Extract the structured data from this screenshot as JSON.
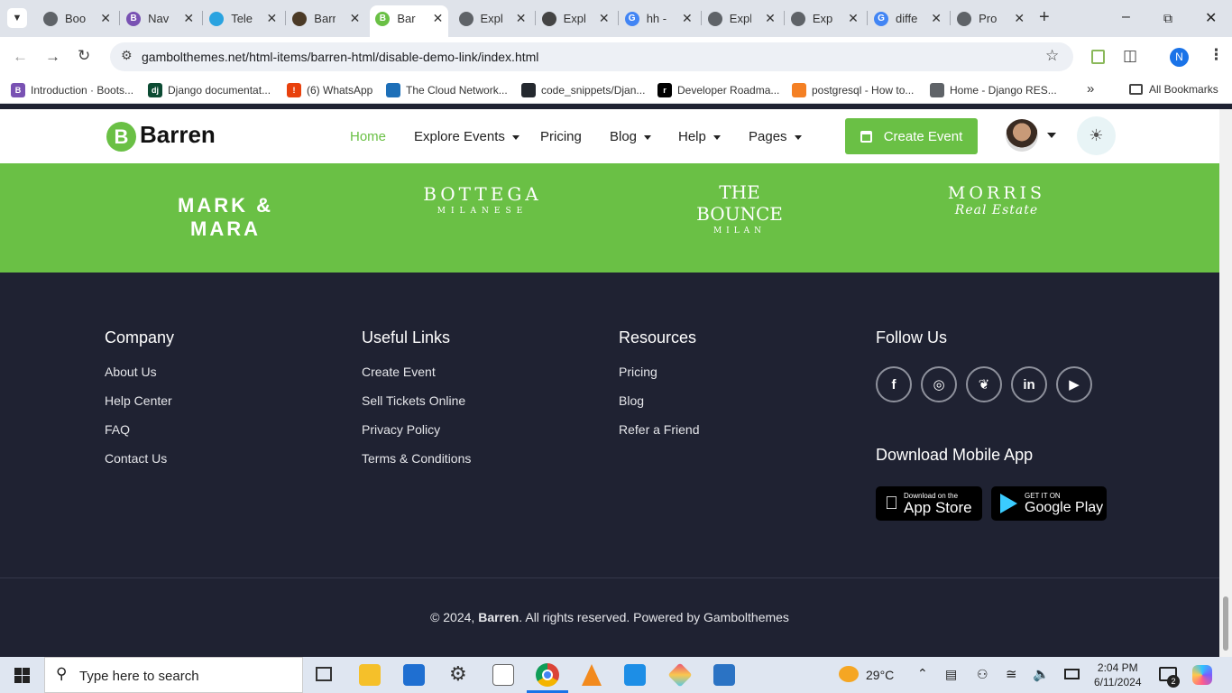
{
  "browser": {
    "tabs": [
      {
        "title": "Boo",
        "color": "#5f6368",
        "glyph": ""
      },
      {
        "title": "Nav",
        "color": "#7952b3",
        "glyph": "B"
      },
      {
        "title": "Tele",
        "color": "#2aa3e0",
        "glyph": ""
      },
      {
        "title": "Barr",
        "color": "#4b3a26",
        "glyph": ""
      },
      {
        "title": "Bar",
        "color": "#6ac045",
        "glyph": "B"
      },
      {
        "title": "Expl",
        "color": "#5f6368",
        "glyph": ""
      },
      {
        "title": "Expl",
        "color": "#444",
        "glyph": ""
      },
      {
        "title": "hh -",
        "color": "#4285f4",
        "glyph": "G"
      },
      {
        "title": "Expl",
        "color": "#5f6368",
        "glyph": ""
      },
      {
        "title": "Exp",
        "color": "#5f6368",
        "glyph": ""
      },
      {
        "title": "diffe",
        "color": "#4285f4",
        "glyph": "G"
      },
      {
        "title": "Pro",
        "color": "#5f6368",
        "glyph": ""
      }
    ],
    "url": "gambolthemes.net/html-items/barren-html/disable-demo-link/index.html",
    "profile_initial": "N",
    "bookmarks": [
      {
        "label": "Introduction · Boots...",
        "color": "#7952b3",
        "glyph": "B"
      },
      {
        "label": "Django documentat...",
        "color": "#0c4b33",
        "glyph": "dj"
      },
      {
        "label": "(6) WhatsApp",
        "color": "#e8410d",
        "glyph": "!"
      },
      {
        "label": "The Cloud Network...",
        "color": "#1d6fb8",
        "glyph": ""
      },
      {
        "label": "code_snippets/Djan...",
        "color": "#24292f",
        "glyph": ""
      },
      {
        "label": "Developer Roadma...",
        "color": "#000",
        "glyph": "r"
      },
      {
        "label": "postgresql - How to...",
        "color": "#f48024",
        "glyph": ""
      },
      {
        "label": "Home - Django RES...",
        "color": "#5f6368",
        "glyph": ""
      }
    ],
    "all_bookmarks": "All Bookmarks"
  },
  "site": {
    "logo_letter": "B",
    "logo_name": "Barren",
    "nav": [
      {
        "label": "Home",
        "active": true,
        "caret": false
      },
      {
        "label": "Explore Events",
        "active": false,
        "caret": true
      },
      {
        "label": "Pricing",
        "active": false,
        "caret": false
      },
      {
        "label": "Blog",
        "active": false,
        "caret": true
      },
      {
        "label": "Help",
        "active": false,
        "caret": true
      },
      {
        "label": "Pages",
        "active": false,
        "caret": true
      }
    ],
    "create_event": "Create Event",
    "accent": "#6ac045",
    "partners": [
      {
        "line1": "MARK & MARA",
        "line2": ""
      },
      {
        "line1": "BOTTEGA",
        "line2": "MILANESE"
      },
      {
        "line1": "THE BOUNCE",
        "line2": "MILAN"
      },
      {
        "line1": "MORRIS",
        "line2": "Real Estate"
      }
    ]
  },
  "footer": {
    "company": {
      "heading": "Company",
      "links": [
        "About Us",
        "Help Center",
        "FAQ",
        "Contact Us"
      ]
    },
    "useful": {
      "heading": "Useful Links",
      "links": [
        "Create Event",
        "Sell Tickets Online",
        "Privacy Policy",
        "Terms & Conditions"
      ]
    },
    "resources": {
      "heading": "Resources",
      "links": [
        "Pricing",
        "Blog",
        "Refer a Friend"
      ]
    },
    "follow": {
      "heading": "Follow Us",
      "icons": [
        "facebook-icon",
        "instagram-icon",
        "twitter-icon",
        "linkedin-icon",
        "youtube-icon"
      ]
    },
    "app": {
      "heading": "Download Mobile App",
      "appstore_small": "Download on the",
      "appstore_big": "App Store",
      "play_small": "GET IT ON",
      "play_big": "Google Play"
    },
    "copyright_prefix": "© 2024, ",
    "copyright_brand": "Barren",
    "copyright_suffix": ". All rights reserved. Powered by Gambolthemes"
  },
  "taskbar": {
    "search_placeholder": "Type here to search",
    "temperature": "29°C",
    "time": "2:04 PM",
    "date": "6/11/2024",
    "notifications": "2"
  }
}
